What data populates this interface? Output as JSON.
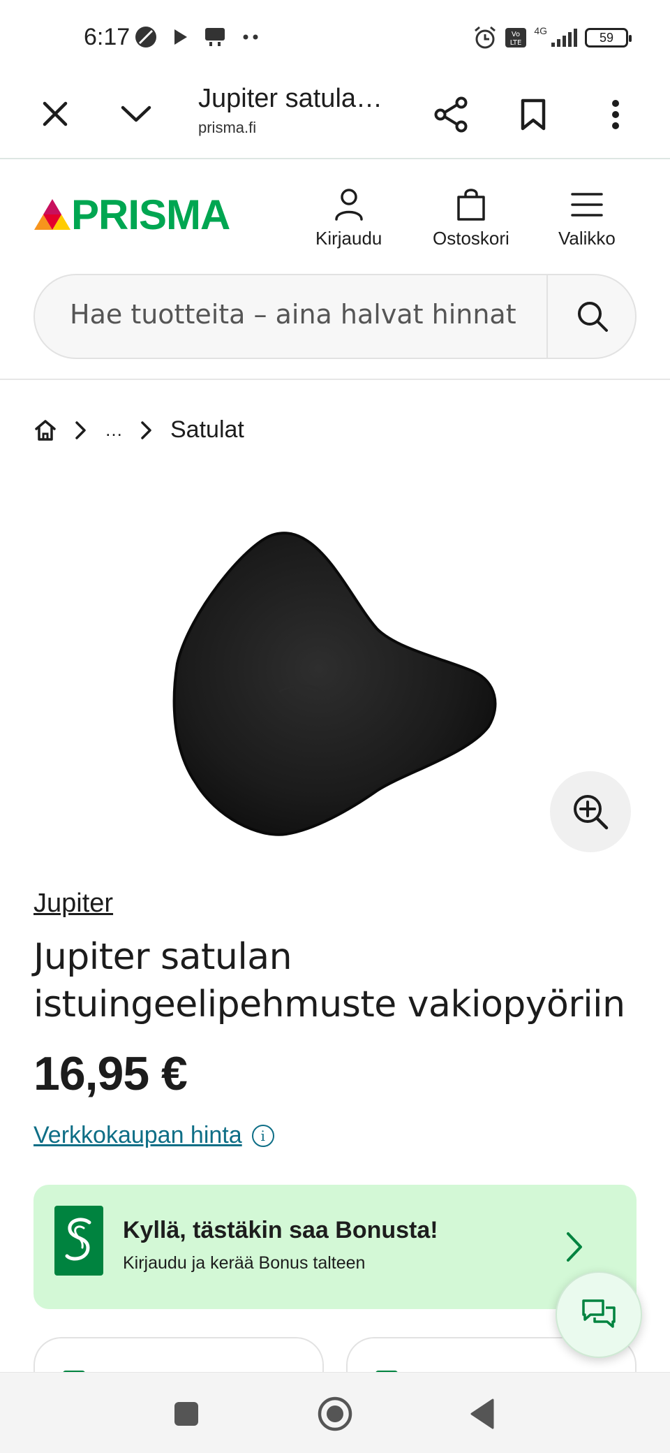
{
  "status_bar": {
    "time": "6:17",
    "network": "4G",
    "battery": "59"
  },
  "browser": {
    "title": "Jupiter satula…",
    "url": "prisma.fi"
  },
  "site": {
    "logo_text": "PRISMA",
    "brand_color": "#00a651",
    "actions": {
      "login": "Kirjaudu",
      "cart": "Ostoskori",
      "menu": "Valikko"
    },
    "search": {
      "placeholder": "Hae tuotteita – aina halvat hinnat"
    }
  },
  "breadcrumb": {
    "ellipsis": "…",
    "current": "Satulat"
  },
  "product": {
    "brand": "Jupiter",
    "title": "Jupiter satulan istuingeelipehmuste vakiopyöriin",
    "price": "16,95 €",
    "price_link": "Verkkokaupan hinta",
    "info_symbol": "i"
  },
  "bonus": {
    "title": "Kyllä, tästäkin saa Bonusta!",
    "subtitle": "Kirjaudu ja kerää Bonus talteen",
    "bg_color": "#d3f8d6"
  },
  "accent_link_color": "#0e6e86"
}
